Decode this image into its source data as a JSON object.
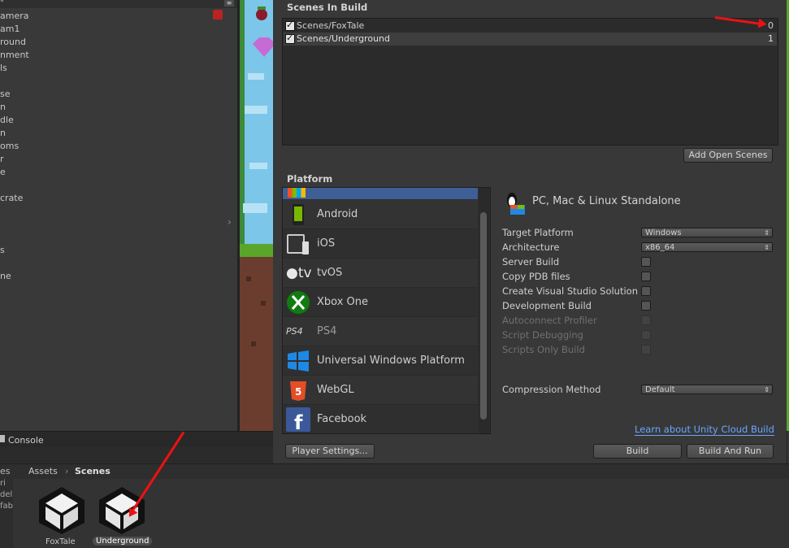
{
  "hierarchy": {
    "items": [
      "amera",
      "am1",
      "round",
      "nment",
      "ls",
      "se",
      "n",
      "dle",
      "n",
      "oms",
      "r",
      "e",
      "crate",
      "s",
      "ne"
    ]
  },
  "console": {
    "tab_label": "Console"
  },
  "project": {
    "breadcrumb_root": "Assets",
    "breadcrumb_current": "Scenes",
    "left_items": [
      "es",
      "ri",
      "del",
      "fab"
    ],
    "assets": [
      {
        "name": "FoxTale",
        "selected": false
      },
      {
        "name": "Underground",
        "selected": true
      }
    ]
  },
  "build": {
    "scenes_title": "Scenes In Build",
    "scenes": [
      {
        "path": "Scenes/FoxTale",
        "index": "0",
        "checked": true
      },
      {
        "path": "Scenes/Underground",
        "index": "1",
        "checked": true
      }
    ],
    "add_open_scenes": "Add Open Scenes",
    "platform_title": "Platform",
    "platforms": [
      {
        "name": "Android",
        "icon": "android-icon"
      },
      {
        "name": "iOS",
        "icon": "ios-icon"
      },
      {
        "name": "tvOS",
        "icon": "tvos-icon"
      },
      {
        "name": "Xbox One",
        "icon": "xbox-icon"
      },
      {
        "name": "PS4",
        "icon": "ps4-icon"
      },
      {
        "name": "Universal Windows Platform",
        "icon": "windows-icon"
      },
      {
        "name": "WebGL",
        "icon": "html5-icon"
      },
      {
        "name": "Facebook",
        "icon": "facebook-icon"
      }
    ],
    "selected_platform_title": "PC, Mac & Linux Standalone",
    "settings": {
      "target_platform_label": "Target Platform",
      "target_platform_value": "Windows",
      "architecture_label": "Architecture",
      "architecture_value": "x86_64",
      "server_build": "Server Build",
      "copy_pdb": "Copy PDB files",
      "create_vs": "Create Visual Studio Solution",
      "development_build": "Development Build",
      "autoconnect": "Autoconnect Profiler",
      "script_debugging": "Script Debugging",
      "scripts_only": "Scripts Only Build",
      "compression_label": "Compression Method",
      "compression_value": "Default"
    },
    "learn_link": "Learn about Unity Cloud Build",
    "player_settings": "Player Settings...",
    "build_button": "Build",
    "build_and_run_button": "Build And Run"
  },
  "colors": {
    "accent_selected": "#3e5f96",
    "annotation_arrow": "#ee1111",
    "link": "#6aa5ff"
  }
}
